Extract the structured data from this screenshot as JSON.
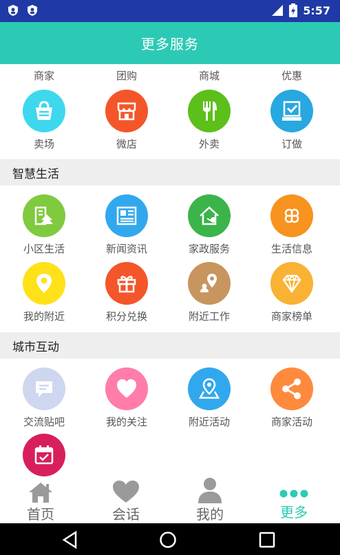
{
  "status": {
    "time": "5:57"
  },
  "header": {
    "title": "更多服务"
  },
  "top_labels": [
    "商家",
    "团购",
    "商城",
    "优惠"
  ],
  "row_shop": [
    {
      "label": "卖场",
      "icon": "shopping-bag-icon",
      "color": "#3ed8ee"
    },
    {
      "label": "微店",
      "icon": "storefront-icon",
      "color": "#f4562a"
    },
    {
      "label": "外卖",
      "icon": "fork-knife-icon",
      "color": "#5cbf1a"
    },
    {
      "label": "订做",
      "icon": "order-check-icon",
      "color": "#27a8e0"
    }
  ],
  "sections": [
    {
      "title": "智慧生活"
    },
    {
      "title": "城市互动"
    }
  ],
  "smart_life": [
    {
      "label": "小区生活",
      "icon": "community-icon",
      "color": "#7fca3e"
    },
    {
      "label": "新闻资讯",
      "icon": "newspaper-icon",
      "color": "#31a8ee"
    },
    {
      "label": "家政服务",
      "icon": "home-service-icon",
      "color": "#3bb44a"
    },
    {
      "label": "生活信息",
      "icon": "clover-icon",
      "color": "#f7931e"
    },
    {
      "label": "我的附近",
      "icon": "location-pin-icon",
      "color": "#ffe11a"
    },
    {
      "label": "积分兑换",
      "icon": "gift-icon",
      "color": "#f4562a"
    },
    {
      "label": "附近工作",
      "icon": "work-nearby-icon",
      "color": "#c8955f"
    },
    {
      "label": "商家榜单",
      "icon": "diamond-icon",
      "color": "#f9b233"
    }
  ],
  "city": [
    {
      "label": "交流贴吧",
      "icon": "chat-icon",
      "color": "#cfd6ef"
    },
    {
      "label": "我的关注",
      "icon": "heart-icon",
      "color": "#ff7cab"
    },
    {
      "label": "附近活动",
      "icon": "map-pin-icon",
      "color": "#31a8ee"
    },
    {
      "label": "商家活动",
      "icon": "share-icon",
      "color": "#ff8a3d"
    },
    {
      "label": "",
      "icon": "calendar-icon",
      "color": "#d81f5c"
    }
  ],
  "tabs": [
    {
      "label": "首页",
      "icon": "home-icon"
    },
    {
      "label": "会话",
      "icon": "heart-icon"
    },
    {
      "label": "我的",
      "icon": "person-icon"
    },
    {
      "label": "更多",
      "icon": "more-dots-icon"
    }
  ],
  "colors": {
    "accent": "#2ccab5",
    "statusbar": "#1f3aa6"
  }
}
